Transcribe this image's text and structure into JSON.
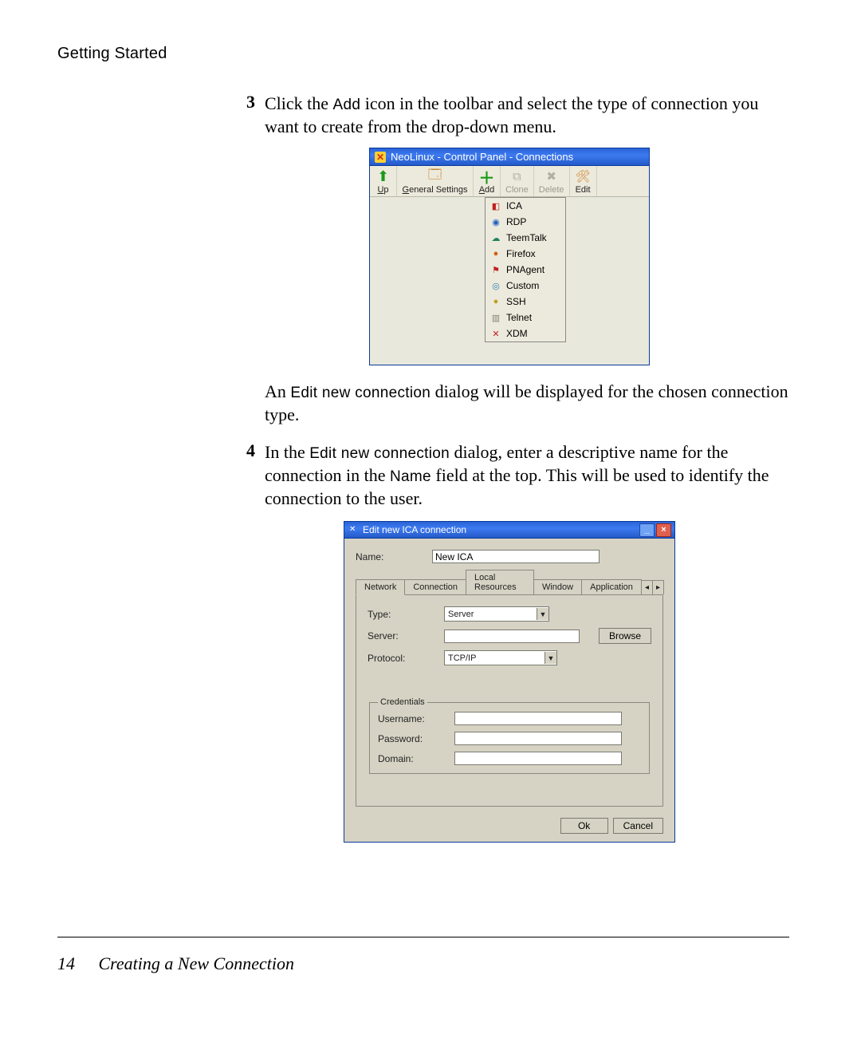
{
  "header": {
    "running_head": "Getting Started"
  },
  "steps": {
    "s3": {
      "num": "3",
      "pre": "Click the ",
      "term": "Add",
      "post": " icon in the toolbar and select the type of connection you want to create from the drop-down menu."
    },
    "mid_para": {
      "pre": "An ",
      "term": "Edit new connection",
      "post": " dialog will be displayed for the chosen connection type."
    },
    "s4": {
      "num": "4",
      "pre": "In the ",
      "term1": "Edit new connection",
      "mid": " dialog, enter a descriptive name for the connection in the ",
      "term2": "Name",
      "post": " field at the top. This will be used to identify the connection to the user."
    }
  },
  "win1": {
    "title": "NeoLinux - Control Panel - Connections",
    "toolbar": {
      "up": "Up",
      "general": "General Settings",
      "add": "Add",
      "clone": "Clone",
      "delete": "Delete",
      "edit": "Edit"
    },
    "menu": [
      "ICA",
      "RDP",
      "TeemTalk",
      "Firefox",
      "PNAgent",
      "Custom",
      "SSH",
      "Telnet",
      "XDM"
    ]
  },
  "win2": {
    "title": "Edit new ICA connection",
    "name_label": "Name:",
    "name_value": "New ICA",
    "tabs": [
      "Network",
      "Connection",
      "Local Resources",
      "Window",
      "Application"
    ],
    "scroll_left": "◂",
    "scroll_right": "▸",
    "network": {
      "type_label": "Type:",
      "type_value": "Server",
      "server_label": "Server:",
      "server_value": "",
      "browse": "Browse",
      "protocol_label": "Protocol:",
      "protocol_value": "TCP/IP"
    },
    "credentials": {
      "legend": "Credentials",
      "username_label": "Username:",
      "username_value": "",
      "password_label": "Password:",
      "password_value": "",
      "domain_label": "Domain:",
      "domain_value": ""
    },
    "ok": "Ok",
    "cancel": "Cancel"
  },
  "footer": {
    "page": "14",
    "title": "Creating a New Connection"
  }
}
